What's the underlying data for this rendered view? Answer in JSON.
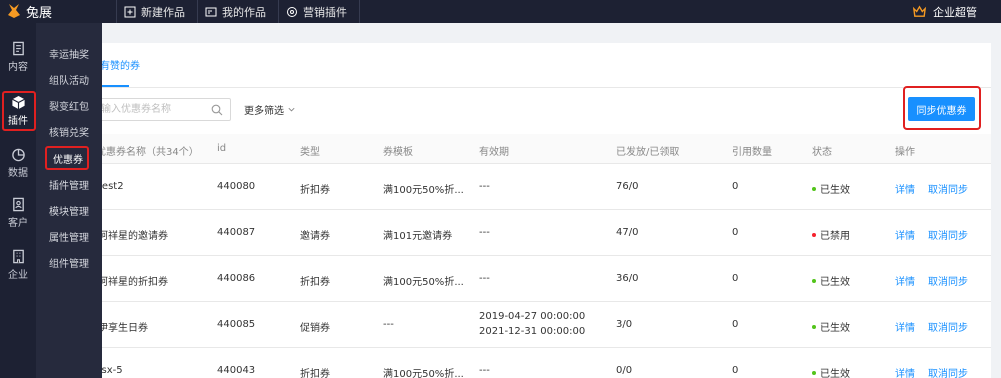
{
  "app": {
    "logo_text": "兔展"
  },
  "topnav": [
    {
      "label": "新建作品",
      "icon": "plus-square-icon"
    },
    {
      "label": "我的作品",
      "icon": "folder-icon"
    },
    {
      "label": "营销插件",
      "icon": "gear-icon"
    }
  ],
  "user": {
    "label": "企业超管",
    "icon": "crown-icon"
  },
  "rail": [
    {
      "label": "内容",
      "icon": "document-icon",
      "active": false
    },
    {
      "label": "插件",
      "icon": "box-icon",
      "active": true
    },
    {
      "label": "数据",
      "icon": "pie-chart-icon",
      "active": false
    },
    {
      "label": "客户",
      "icon": "contact-card-icon",
      "active": false
    },
    {
      "label": "企业",
      "icon": "building-icon",
      "active": false
    }
  ],
  "submenu": [
    {
      "label": "幸运抽奖",
      "active": false
    },
    {
      "label": "组队活动",
      "active": false
    },
    {
      "label": "裂变红包",
      "active": false
    },
    {
      "label": "核销兑奖",
      "active": false
    },
    {
      "label": "优惠券",
      "active": true
    },
    {
      "label": "插件管理",
      "active": false
    },
    {
      "label": "模块管理",
      "active": false
    },
    {
      "label": "属性管理",
      "active": false
    },
    {
      "label": "组件管理",
      "active": false
    }
  ],
  "main": {
    "tab_label": "有赞的券",
    "search_placeholder": "输入优惠券名称",
    "more_filter_label": "更多筛选",
    "sync_button_label": "同步优惠券"
  },
  "table": {
    "headers": [
      "优惠券名称（共34个）",
      "id",
      "类型",
      "券模板",
      "有效期",
      "已发放/已领取",
      "引用数量",
      "状态",
      "操作"
    ],
    "rows": [
      {
        "name": "test2",
        "id": "440080",
        "type": "折扣券",
        "template": "满100元50%折...",
        "validity_1": "---",
        "validity_2": "",
        "issued": "76/0",
        "refs": "0",
        "status": "已生效",
        "status_color": "#52c41a",
        "action_detail": "详情",
        "action_cancel": "取消同步"
      },
      {
        "name": "柯祥星的邀请券",
        "id": "440087",
        "type": "邀请券",
        "template": "满101元邀请券",
        "validity_1": "---",
        "validity_2": "",
        "issued": "47/0",
        "refs": "0",
        "status": "已禁用",
        "status_color": "#f5222d",
        "action_detail": "详情",
        "action_cancel": "取消同步"
      },
      {
        "name": "柯祥星的折扣券",
        "id": "440086",
        "type": "折扣券",
        "template": "满100元50%折...",
        "validity_1": "---",
        "validity_2": "",
        "issued": "36/0",
        "refs": "0",
        "status": "已生效",
        "status_color": "#52c41a",
        "action_detail": "详情",
        "action_cancel": "取消同步"
      },
      {
        "name": "伊享生日券",
        "id": "440085",
        "type": "促销券",
        "template": "---",
        "validity_1": "2019-04-27 00:00:00",
        "validity_2": "2021-12-31 00:00:00",
        "issued": "3/0",
        "refs": "0",
        "status": "已生效",
        "status_color": "#52c41a",
        "action_detail": "详情",
        "action_cancel": "取消同步"
      },
      {
        "name": "fsx-5",
        "id": "440043",
        "type": "折扣券",
        "template": "满100元50%折...",
        "validity_1": "---",
        "validity_2": "",
        "issued": "0/0",
        "refs": "0",
        "status": "已生效",
        "status_color": "#52c41a",
        "action_detail": "详情",
        "action_cancel": "取消同步"
      }
    ]
  },
  "colors": {
    "accent": "#1890ff",
    "sidebar": "#1d2133",
    "highlight": "#e02020"
  }
}
